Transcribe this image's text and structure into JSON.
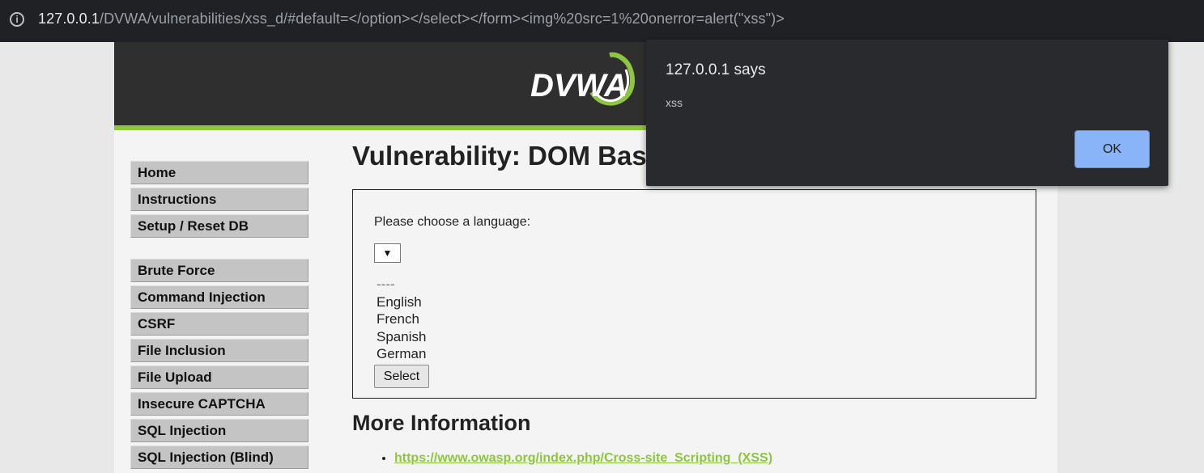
{
  "browser": {
    "url_host": "127.0.0.1",
    "url_path": "/DVWA/vulnerabilities/xss_d/#default=</option></select></form><img%20src=1%20onerror=alert(\"xss\")>",
    "info_icon": "info-icon"
  },
  "header": {
    "logo_text": "DVWA"
  },
  "sidebar": {
    "group1": [
      "Home",
      "Instructions",
      "Setup / Reset DB"
    ],
    "group2": [
      "Brute Force",
      "Command Injection",
      "CSRF",
      "File Inclusion",
      "File Upload",
      "Insecure CAPTCHA",
      "SQL Injection",
      "SQL Injection (Blind)"
    ]
  },
  "main": {
    "title": "Vulnerability: DOM Bas",
    "prompt": "Please choose a language:",
    "select_arrow": "▼",
    "options": [
      "----",
      "English",
      "French",
      "Spanish",
      "German"
    ],
    "select_button": "Select",
    "more_info_title": "More Information",
    "links": [
      "https://www.owasp.org/index.php/Cross-site_Scripting_(XSS)"
    ]
  },
  "dialog": {
    "title": "127.0.0.1 says",
    "message": "xss",
    "ok_label": "OK"
  },
  "colors": {
    "accent_green": "#8dc63f",
    "dialog_bg": "#292a2d",
    "ok_button": "#8ab4f8"
  }
}
